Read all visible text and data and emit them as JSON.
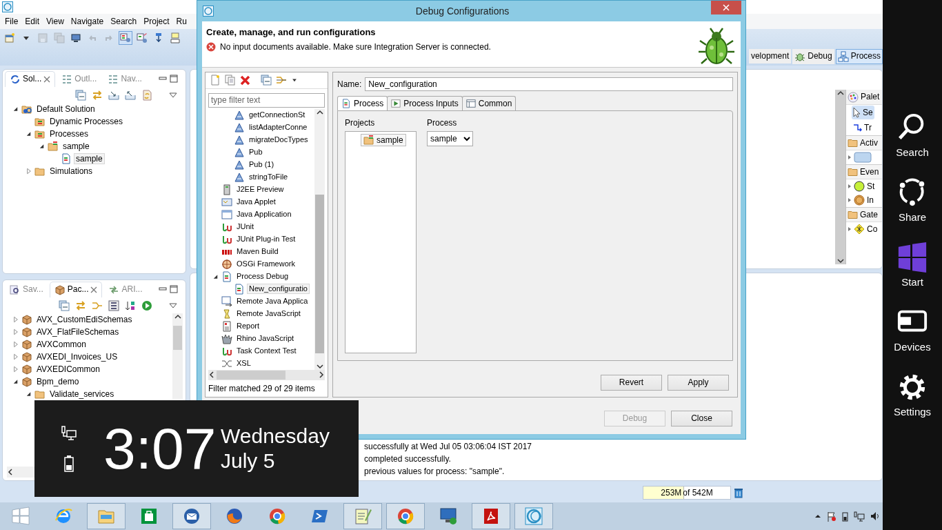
{
  "ide": {
    "menu": [
      "File",
      "Edit",
      "View",
      "Navigate",
      "Search",
      "Project",
      "Ru"
    ],
    "toolbar": [
      {
        "kind": "new",
        "pressed": false,
        "disabled": false
      },
      {
        "kind": "dropdown",
        "pressed": false,
        "disabled": false
      },
      {
        "kind": "save",
        "pressed": false,
        "disabled": true
      },
      {
        "kind": "saveall",
        "pressed": false,
        "disabled": true
      },
      {
        "kind": "monitor",
        "pressed": false,
        "disabled": false
      },
      {
        "kind": "undo",
        "pressed": false,
        "disabled": true
      },
      {
        "kind": "redo",
        "pressed": false,
        "disabled": true
      },
      {
        "kind": "model",
        "pressed": true,
        "disabled": false
      },
      {
        "kind": "modeledit",
        "pressed": false,
        "disabled": false
      },
      {
        "kind": "pin",
        "pressed": false,
        "disabled": false
      },
      {
        "kind": "note",
        "pressed": false,
        "disabled": false
      }
    ],
    "perspectives": [
      {
        "label": "velopment",
        "kind": "none",
        "selected": false
      },
      {
        "label": "Debug",
        "kind": "bug",
        "selected": false
      },
      {
        "label": "Process",
        "kind": "process",
        "selected": true
      }
    ],
    "solution_panel": {
      "tabs": [
        {
          "label": "Sol...",
          "kind": "sync",
          "selected": true
        },
        {
          "label": "Outl...",
          "kind": "outline",
          "selected": false
        },
        {
          "label": "Nav...",
          "kind": "outline",
          "selected": false
        }
      ],
      "tree": [
        {
          "label": "Default Solution",
          "kind": "solution",
          "expanded": true,
          "selected": false,
          "children": [
            {
              "label": "Dynamic Processes",
              "kind": "processes",
              "selected": false
            },
            {
              "label": "Processes",
              "kind": "processes",
              "expanded": true,
              "selected": false,
              "children": [
                {
                  "label": "sample",
                  "kind": "project",
                  "expanded": true,
                  "selected": false,
                  "children": [
                    {
                      "label": "sample",
                      "kind": "process",
                      "selected": true
                    }
                  ]
                }
              ]
            },
            {
              "label": "Simulations",
              "kind": "folder",
              "expanded": false,
              "selected": false
            }
          ]
        }
      ]
    },
    "package_panel": {
      "tabs": [
        {
          "label": "Sav...",
          "kind": "search",
          "selected": false
        },
        {
          "label": "Pac...",
          "kind": "package",
          "selected": true
        },
        {
          "label": "ARI...",
          "kind": "arrows",
          "selected": false
        }
      ],
      "tree": [
        {
          "label": "AVX_CustomEdiSchemas",
          "kind": "package",
          "expanded": false,
          "selected": false
        },
        {
          "label": "AVX_FlatFileSchemas",
          "kind": "package",
          "expanded": false,
          "selected": false
        },
        {
          "label": "AVXCommon",
          "kind": "package",
          "expanded": false,
          "selected": false
        },
        {
          "label": "AVXEDI_Invoices_US",
          "kind": "package",
          "expanded": false,
          "selected": false
        },
        {
          "label": "AVXEDICommon",
          "kind": "package",
          "expanded": false,
          "selected": false
        },
        {
          "label": "Bpm_demo",
          "kind": "package",
          "expanded": true,
          "selected": false,
          "children": [
            {
              "label": "Validate_services",
              "kind": "folder",
              "expanded": true,
              "selected": false
            }
          ]
        }
      ]
    },
    "palette": {
      "header": "Palet",
      "tools": [
        {
          "label": "Se",
          "kind": "select",
          "selected": true
        },
        {
          "label": "Tr",
          "kind": "transition",
          "selected": false
        }
      ],
      "drawers": [
        {
          "label": "Activ",
          "items": [
            {
              "kind": "task"
            }
          ]
        },
        {
          "label": "Even",
          "items": [
            {
              "kind": "start",
              "label": "St"
            },
            {
              "kind": "intermediate",
              "label": "In"
            }
          ]
        },
        {
          "label": "Gate",
          "items": [
            {
              "kind": "gateway",
              "label": "Co"
            }
          ]
        }
      ]
    },
    "console": {
      "lines": [
        "successfully at Wed Jul 05 03:06:04 IST 2017",
        "completed  successfully.",
        "previous values for process: \"sample\"."
      ]
    },
    "heap": {
      "used": "253M",
      "total": "of 542M",
      "level": 0.47
    }
  },
  "dialog": {
    "title": "Debug Configurations",
    "heading": "Create, manage, and run configurations",
    "message": {
      "kind": "error",
      "text": "No input documents available. Make sure Integration Server is connected."
    },
    "filter": {
      "placeholder": "type filter text"
    },
    "tree": {
      "scrolled_children": [
        {
          "label": "getConnectionSt",
          "kind": "service",
          "selected": false
        },
        {
          "label": "listAdapterConne",
          "kind": "service",
          "selected": false
        },
        {
          "label": "migrateDocTypes",
          "kind": "service",
          "selected": false
        },
        {
          "label": "Pub",
          "kind": "service",
          "selected": false
        },
        {
          "label": "Pub (1)",
          "kind": "service",
          "selected": false
        },
        {
          "label": "stringToFile",
          "kind": "service",
          "selected": false
        }
      ],
      "items": [
        {
          "label": "J2EE Preview",
          "kind": "j2ee",
          "selected": false
        },
        {
          "label": "Java Applet",
          "kind": "applet",
          "selected": false
        },
        {
          "label": "Java Application",
          "kind": "javaapp",
          "selected": false
        },
        {
          "label": "JUnit",
          "kind": "junit",
          "selected": false
        },
        {
          "label": "JUnit Plug-in Test",
          "kind": "junit",
          "selected": false
        },
        {
          "label": "Maven Build",
          "kind": "maven",
          "selected": false
        },
        {
          "label": "OSGi Framework",
          "kind": "osgi",
          "selected": false
        },
        {
          "label": "Process Debug",
          "kind": "process",
          "expanded": true,
          "selected": false,
          "children": [
            {
              "label": "New_configuratio",
              "kind": "process",
              "selected": true
            }
          ]
        },
        {
          "label": "Remote Java Applica",
          "kind": "remote",
          "selected": false
        },
        {
          "label": "Remote JavaScript",
          "kind": "script",
          "selected": false
        },
        {
          "label": "Report",
          "kind": "report",
          "selected": false
        },
        {
          "label": "Rhino JavaScript",
          "kind": "rhino",
          "selected": false
        },
        {
          "label": "Task Context Test",
          "kind": "junit",
          "selected": false
        },
        {
          "label": "XSL",
          "kind": "xsl",
          "selected": false
        }
      ]
    },
    "filter_status": "Filter matched 29 of 29 items",
    "name": {
      "label": "Name:",
      "value": "New_configuration"
    },
    "tabs": [
      {
        "label": "Process",
        "kind": "process",
        "selected": true
      },
      {
        "label": "Process Inputs",
        "kind": "inputs",
        "selected": false
      },
      {
        "label": "Common",
        "kind": "common",
        "selected": false
      }
    ],
    "projects": {
      "label": "Projects",
      "items": [
        {
          "label": "sample",
          "selected": true
        }
      ]
    },
    "process": {
      "label": "Process",
      "value": "sample"
    },
    "buttons": [
      {
        "label": "Revert",
        "disabled": false
      },
      {
        "label": "Apply",
        "disabled": false
      }
    ],
    "footer_buttons": [
      {
        "label": "Debug",
        "disabled": true
      },
      {
        "label": "Close",
        "disabled": false
      }
    ]
  },
  "lock_overlay": {
    "time": "3:07",
    "day": "Wednesday",
    "date": "July 5"
  },
  "charms": [
    {
      "label": "Search",
      "kind": "search"
    },
    {
      "label": "Share",
      "kind": "share"
    },
    {
      "label": "Start",
      "kind": "start"
    },
    {
      "label": "Devices",
      "kind": "devices"
    },
    {
      "label": "Settings",
      "kind": "settings"
    }
  ],
  "taskbar": {
    "apps": [
      {
        "kind": "start",
        "open": false
      },
      {
        "kind": "ie",
        "open": false
      },
      {
        "kind": "explorer",
        "open": true
      },
      {
        "kind": "store",
        "open": false
      },
      {
        "kind": "mail",
        "open": true
      },
      {
        "kind": "firefox",
        "open": false
      },
      {
        "kind": "chrome",
        "open": false
      },
      {
        "kind": "shell",
        "open": false
      },
      {
        "kind": "notepad",
        "open": true
      },
      {
        "kind": "chrome",
        "open": true
      },
      {
        "kind": "remote",
        "open": false
      },
      {
        "kind": "pdf",
        "open": true
      },
      {
        "kind": "ring",
        "open": true
      }
    ]
  }
}
